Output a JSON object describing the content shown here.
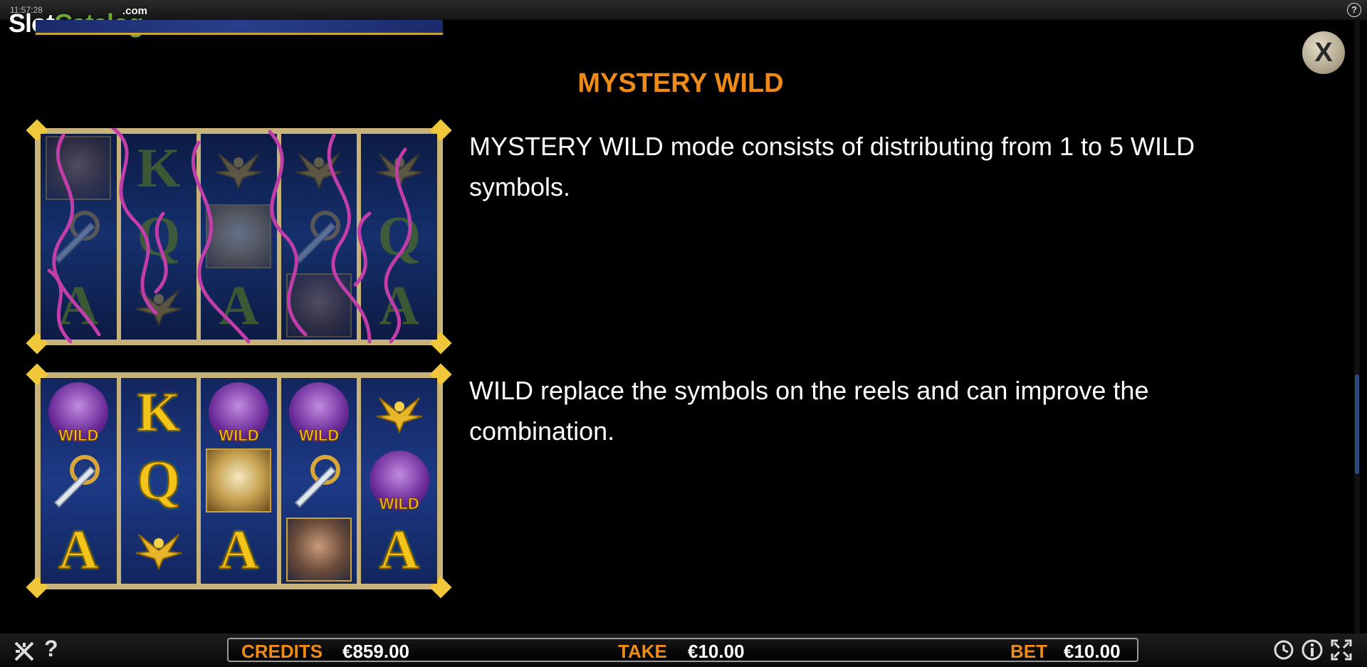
{
  "status": {
    "clock": "11:57:28"
  },
  "brand": {
    "logo_slot": "Slot",
    "logo_catalog": "Catalog",
    "logo_com": ".com"
  },
  "top": {
    "help_glyph": "?"
  },
  "close_button": {
    "label": "X"
  },
  "panel": {
    "title": "MYSTERY WILD",
    "paragraph_1": "MYSTERY WILD mode consists of distributing from 1 to 5 WILD symbols.",
    "paragraph_2": "WILD replace the symbols on the reels and can improve the combination."
  },
  "grid_before": {
    "reels": [
      [
        "warrior",
        "sword",
        "A"
      ],
      [
        "K",
        "Q",
        "eagle"
      ],
      [
        "eagle",
        "zeus",
        "A"
      ],
      [
        "eagle",
        "sword",
        "warrior"
      ],
      [
        "eagle",
        "Q",
        "A"
      ]
    ]
  },
  "grid_after": {
    "wild_label": "WILD",
    "reels": [
      [
        "WILD",
        "sword",
        "A"
      ],
      [
        "K",
        "Q",
        "eagle"
      ],
      [
        "WILD",
        "zeus",
        "A"
      ],
      [
        "WILD",
        "sword",
        "warrior"
      ],
      [
        "eagle",
        "WILD",
        "A"
      ]
    ]
  },
  "footer": {
    "help_glyph": "?",
    "credits_label": "CREDITS",
    "credits_value": "€859.00",
    "take_label": "TAKE",
    "take_value": "€10.00",
    "bet_label": "BET",
    "bet_value": "€10.00",
    "icons": [
      "settings-icon",
      "help-icon",
      "history-icon",
      "info-icon",
      "fullscreen-icon"
    ]
  },
  "colors": {
    "accent": "#ee8a17",
    "frame": "#c7b27a",
    "reel_bg": "#1d3a86"
  }
}
